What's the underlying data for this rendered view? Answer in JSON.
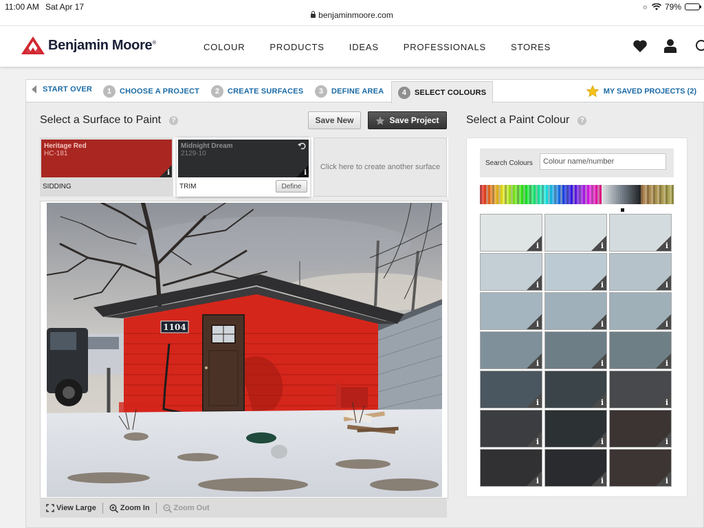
{
  "status_bar": {
    "time": "11:00 AM",
    "date": "Sat Apr 17",
    "battery": "79%",
    "battery_level": 0.79
  },
  "browser": {
    "url": "benjaminmoore.com"
  },
  "header": {
    "brand": "Benjamin Moore",
    "brand_mark": "®",
    "brand_color": "#d22630",
    "nav": [
      "COLOUR",
      "PRODUCTS",
      "IDEAS",
      "PROFESSIONALS",
      "STORES"
    ],
    "icons": [
      "heart-icon",
      "account-icon",
      "search-icon"
    ]
  },
  "steps": {
    "start_over": "START OVER",
    "items": [
      {
        "num": "1",
        "label": "CHOOSE A PROJECT"
      },
      {
        "num": "2",
        "label": "CREATE SURFACES"
      },
      {
        "num": "3",
        "label": "DEFINE AREA"
      },
      {
        "num": "4",
        "label": "SELECT COLOURS"
      }
    ],
    "active_step": 4,
    "saved_projects": "MY SAVED PROJECTS (2)"
  },
  "surfaces_panel": {
    "title": "Select a Surface to Paint",
    "help": "?",
    "save_new": "Save New",
    "save_project": "Save Project",
    "surfaces": [
      {
        "name": "Heritage Red",
        "code": "HC-181",
        "label": "SIDDING",
        "color": "#a92621"
      },
      {
        "name": "Midnight Dream",
        "code": "2129-10",
        "label": "TRIM",
        "color": "#2b2d2f",
        "define": "Define"
      }
    ],
    "create_surface": "Click here to create another surface",
    "house_number": "1104",
    "zoom": {
      "view_large": "View Large",
      "zoom_in": "Zoom In",
      "zoom_out": "Zoom Out"
    }
  },
  "palette_panel": {
    "title": "Select a Paint Colour",
    "help": "?",
    "search_label": "Search Colours",
    "search_placeholder": "Colour name/number",
    "info": "i",
    "chips": [
      "#dfe4e5",
      "#d9e0e2",
      "#d4dbde",
      "#c3ced5",
      "#bccbd3",
      "#b5c2c9",
      "#a5b5bf",
      "#9fb0ba",
      "#9fb0b9",
      "#7f909b",
      "#6d7e87",
      "#6f7f86",
      "#4b5760",
      "#3b4449",
      "#47494c",
      "#3b3d41",
      "#2c3134",
      "#3b3432",
      "#313032",
      "#292b2e",
      "#3d3533"
    ]
  }
}
